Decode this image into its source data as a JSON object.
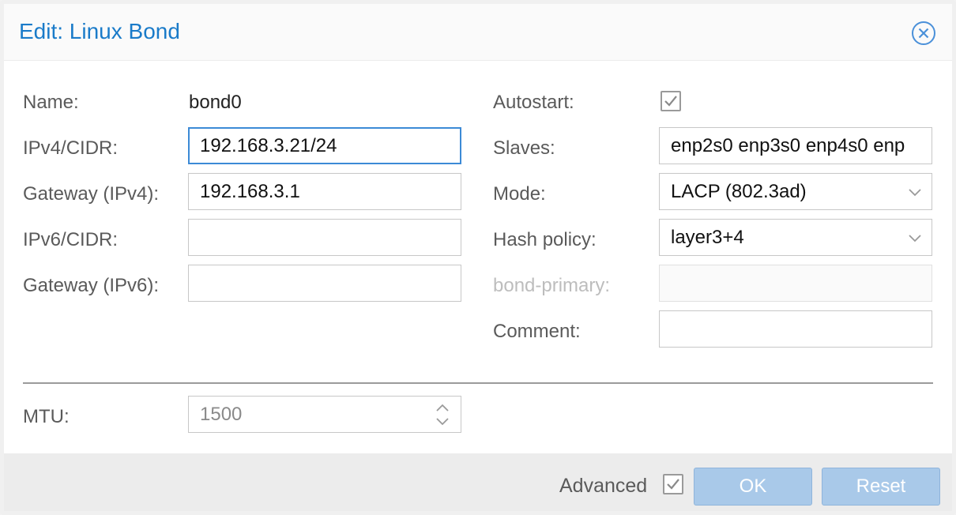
{
  "dialog": {
    "title": "Edit: Linux Bond",
    "close_icon": "close-circle-icon"
  },
  "left": {
    "name_label": "Name:",
    "name_value": "bond0",
    "ipv4_label": "IPv4/CIDR:",
    "ipv4_value": "192.168.3.21/24",
    "gw4_label": "Gateway (IPv4):",
    "gw4_value": "192.168.3.1",
    "ipv6_label": "IPv6/CIDR:",
    "ipv6_value": "",
    "gw6_label": "Gateway (IPv6):",
    "gw6_value": ""
  },
  "right": {
    "autostart_label": "Autostart:",
    "autostart_checked": true,
    "slaves_label": "Slaves:",
    "slaves_value": "enp2s0 enp3s0 enp4s0 enp",
    "mode_label": "Mode:",
    "mode_value": "LACP (802.3ad)",
    "hash_label": "Hash policy:",
    "hash_value": "layer3+4",
    "bond_primary_label": "bond-primary:",
    "bond_primary_value": "",
    "comment_label": "Comment:",
    "comment_value": ""
  },
  "advanced_section": {
    "mtu_label": "MTU:",
    "mtu_value": "1500"
  },
  "footer": {
    "advanced_label": "Advanced",
    "advanced_checked": true,
    "ok_label": "OK",
    "reset_label": "Reset"
  },
  "colors": {
    "accent": "#1a7bc9",
    "button_disabled": "#a9c9e9",
    "focus_border": "#3c8ad6"
  }
}
